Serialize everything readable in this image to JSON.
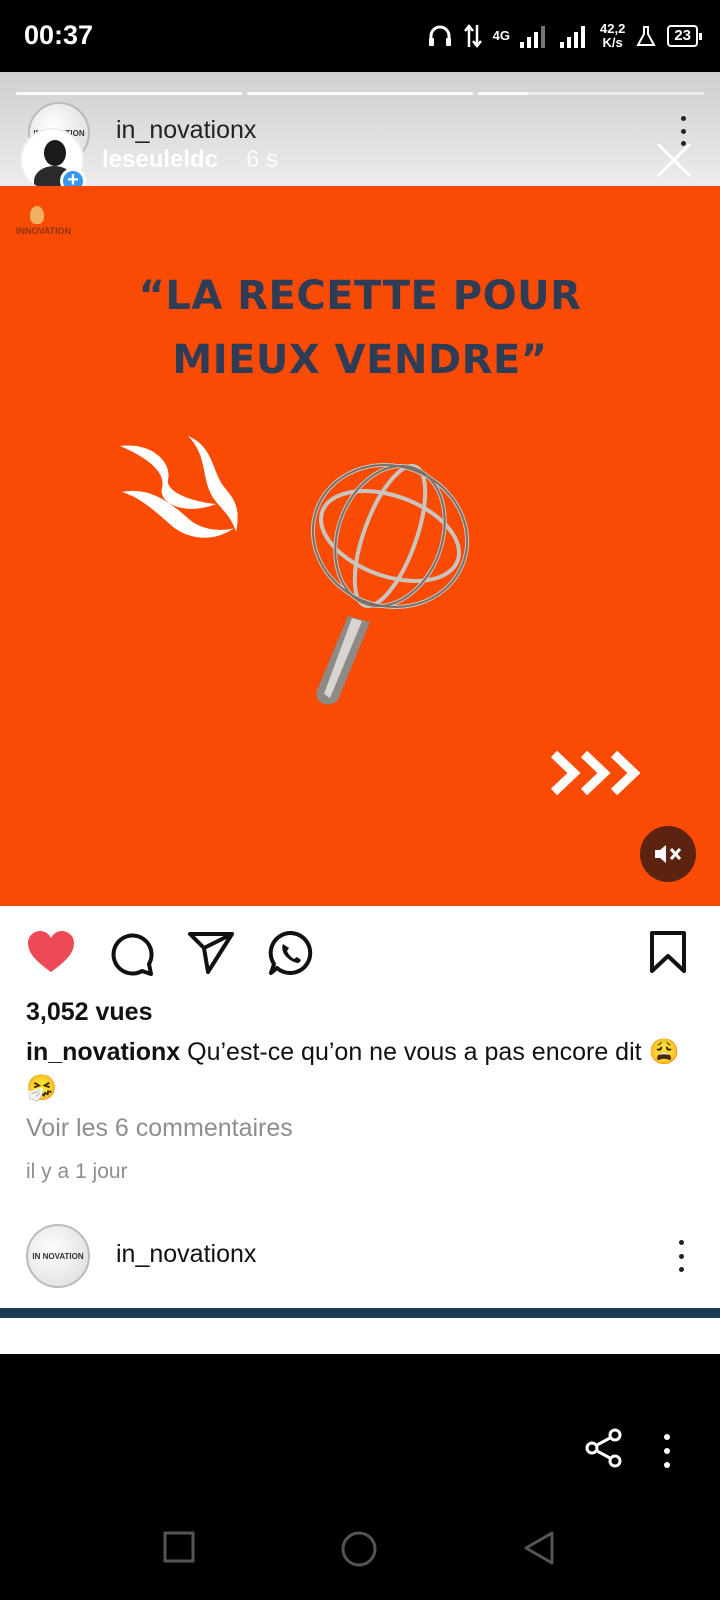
{
  "status_bar": {
    "time": "00:37",
    "network_type": "4G",
    "speed_value": "42,2",
    "speed_unit": "K/s",
    "battery": "23"
  },
  "story": {
    "progress": [
      1,
      1,
      0.22
    ],
    "username": "leseuleldc",
    "time_ago": "6 s"
  },
  "post": {
    "username": "in_novationx",
    "avatar_text": "IN NOVATION",
    "image_logo_text": "INNOVATION",
    "headline_line1": "“LA RECETTE POUR",
    "headline_line2": "MIEUX VENDRE”",
    "views": "3,052 vues",
    "caption_user": "in_novationx",
    "caption_text": " Qu’est-ce qu’on ne vous a pas encore dit 😩🤧",
    "comments_link": "Voir les 6 commentaires",
    "date": "il y a 1 jour",
    "liked": true
  },
  "next_post": {
    "username": "in_novationx",
    "avatar_text": "IN NOVATION"
  },
  "colors": {
    "media_bg": "#fa4b04",
    "headline": "#2f3c55",
    "like": "#ed4956",
    "plus_badge": "#3897f0"
  },
  "icons": [
    "heart-icon",
    "comment-icon",
    "send-icon",
    "whatsapp-icon",
    "bookmark-icon",
    "share-icon",
    "more-icon",
    "mute-icon",
    "close-icon"
  ]
}
